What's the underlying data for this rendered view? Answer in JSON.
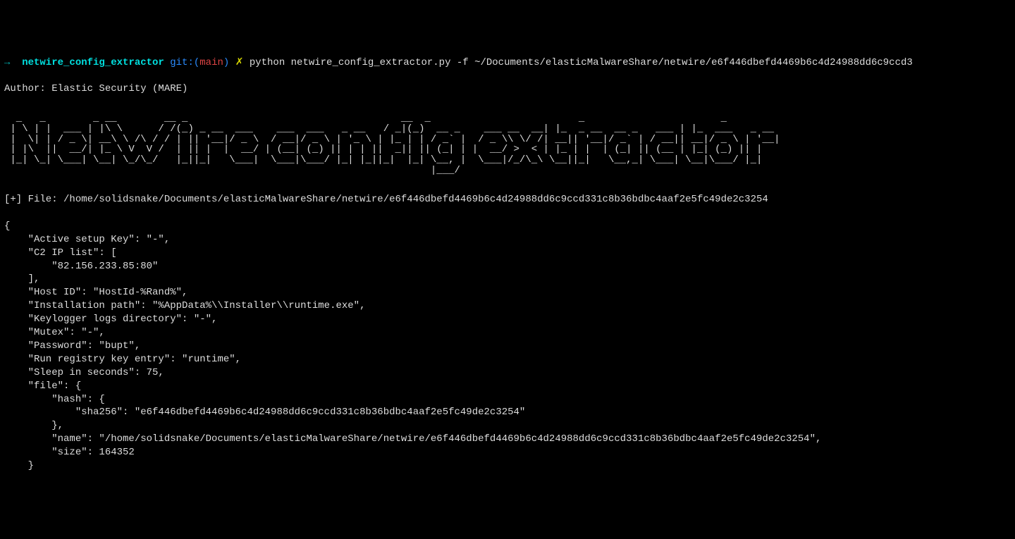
{
  "prompt": {
    "arrow": "→ ",
    "dir": " netwire_config_extractor ",
    "git_label": "git:(",
    "git_branch": "main",
    "git_close": ") ",
    "x": "✗ ",
    "command": "python netwire_config_extractor.py -f ~/Documents/elasticMalwareShare/netwire/e6f446dbefd4469b6c4d24988dd6c9ccd3"
  },
  "author_line": "Author: Elastic Security (MARE)",
  "ascii_art": "  _   _        _ __        __ _                                    __  _                         _                       _\n | \\ | |  ___ | |\\ \\      / /(_) _ __  ___    ___  ___   _ __   / _|(_)  __ _    ___ __  __| |_  _ __  __ _   ___ | |_  ___   _ __\n |  \\| | / _ \\| __\\ \\ /\\ / / | || '__|/ _ \\  / __|/ _ \\ | '_ \\ | |_ | | / _` |  / _ \\\\ \\/ /| __|| '__|/ _` | / __|| __|/ _ \\ | '__|\n | |\\  ||  __/| |_ \\ V  V /  | || |  |  __/ | (__| (_) || | | ||  _|| || (_| | |  __/ >  < | |_ | |  | (_| || (__ | |_| (_) || |\n |_| \\_| \\___| \\__| \\_/\\_/   |_||_|   \\___|  \\___|\\___/ |_| |_||_|  |_| \\__, |  \\___|/_/\\_\\ \\__||_|   \\__,_| \\___| \\__|\\___/ |_|\n                                                                        |___/",
  "file_marker": "[+] File: /home/solidsnake/Documents/elasticMalwareShare/netwire/e6f446dbefd4469b6c4d24988dd6c9ccd331c8b36bdbc4aaf2e5fc49de2c3254",
  "json_output": "{\n    \"Active setup Key\": \"-\",\n    \"C2 IP list\": [\n        \"82.156.233.85:80\"\n    ],\n    \"Host ID\": \"HostId-%Rand%\",\n    \"Installation path\": \"%AppData%\\\\Installer\\\\runtime.exe\",\n    \"Keylogger logs directory\": \"-\",\n    \"Mutex\": \"-\",\n    \"Password\": \"bupt\",\n    \"Run registry key entry\": \"runtime\",\n    \"Sleep in seconds\": 75,\n    \"file\": {\n        \"hash\": {\n            \"sha256\": \"e6f446dbefd4469b6c4d24988dd6c9ccd331c8b36bdbc4aaf2e5fc49de2c3254\"\n        },\n        \"name\": \"/home/solidsnake/Documents/elasticMalwareShare/netwire/e6f446dbefd4469b6c4d24988dd6c9ccd331c8b36bdbc4aaf2e5fc49de2c3254\",\n        \"size\": 164352\n    }"
}
